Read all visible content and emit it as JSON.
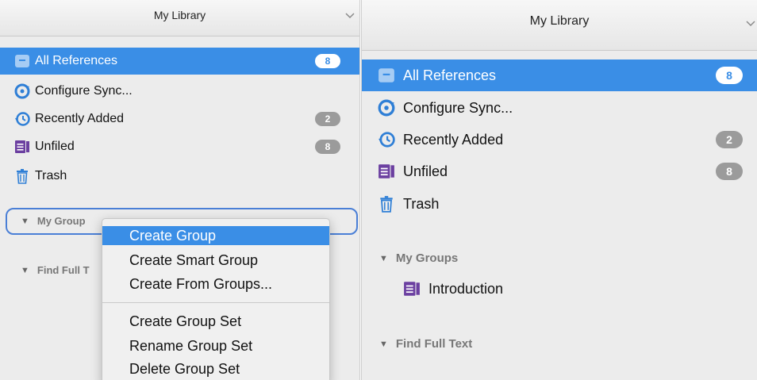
{
  "left": {
    "header_title": "My Library",
    "items": [
      {
        "label": "All References",
        "badge": "8"
      },
      {
        "label": "Configure Sync..."
      },
      {
        "label": "Recently Added",
        "badge": "2"
      },
      {
        "label": "Unfiled",
        "badge": "8"
      },
      {
        "label": "Trash"
      }
    ],
    "my_groups_label": "My Group",
    "find_full_text_label": "Find Full T"
  },
  "context_menu": {
    "items": [
      "Create Group",
      "Create Smart Group",
      "Create From Groups...",
      "Create Group Set",
      "Rename Group Set",
      "Delete Group Set"
    ]
  },
  "right": {
    "header_title": "My Library",
    "items": [
      {
        "label": "All References",
        "badge": "8"
      },
      {
        "label": "Configure Sync..."
      },
      {
        "label": "Recently Added",
        "badge": "2"
      },
      {
        "label": "Unfiled",
        "badge": "8"
      },
      {
        "label": "Trash"
      }
    ],
    "my_groups_label": "My Groups",
    "group_item": "Introduction",
    "find_full_text_label": "Find Full Text"
  },
  "colors": {
    "selection": "#3a8ee6",
    "badge_gray": "#9b9b9b",
    "unfiled_icon": "#6b3fa0",
    "focus_ring": "#4a7fd6"
  },
  "icons": [
    "library-icon",
    "sync-icon",
    "recently-added-icon",
    "unfiled-icon",
    "trash-icon",
    "group-icon",
    "chevron-down-icon",
    "disclosure-triangle-icon"
  ]
}
